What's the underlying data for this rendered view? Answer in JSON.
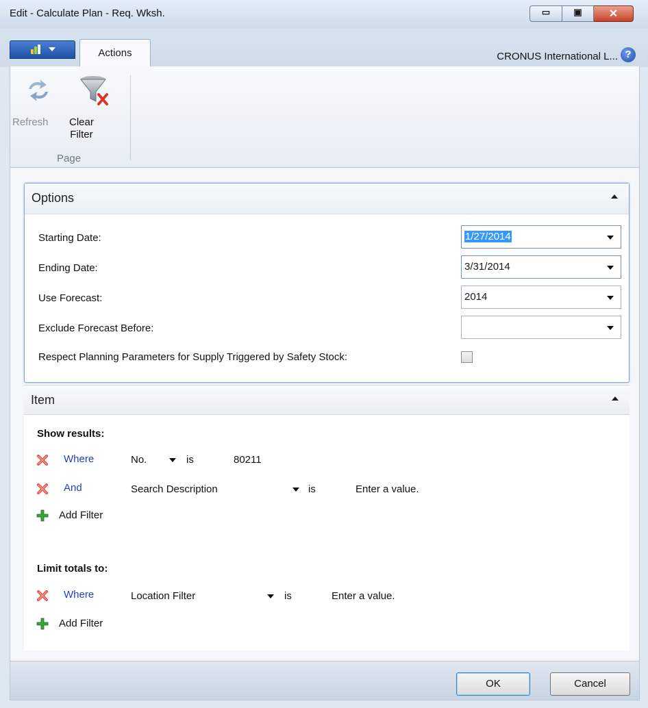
{
  "window": {
    "title": "Edit - Calculate Plan - Req. Wksh."
  },
  "window_controls": {
    "minimize": "▭",
    "maximize": "▣",
    "close": "✕"
  },
  "tabs": [
    {
      "label": "Actions"
    }
  ],
  "header": {
    "company": "CRONUS International L...",
    "help": "?"
  },
  "ribbon": {
    "refresh_label": "Refresh",
    "clear_filter_label_1": "Clear",
    "clear_filter_label_2": "Filter",
    "group_label": "Page"
  },
  "options": {
    "title": "Options",
    "fields": [
      {
        "label": "Starting Date:",
        "value": "1/27/2014"
      },
      {
        "label": "Ending Date:",
        "value": "3/31/2014"
      },
      {
        "label": "Use Forecast:",
        "value": "2014"
      },
      {
        "label": "Exclude Forecast Before:",
        "value": ""
      }
    ],
    "checkbox_label": "Respect Planning Parameters for Supply Triggered by Safety Stock:",
    "checkbox_checked": false
  },
  "item": {
    "title": "Item",
    "show_results_label": "Show results:",
    "filters": [
      {
        "connector": "Where",
        "field": "No.",
        "operator": "is",
        "value": "80211"
      },
      {
        "connector": "And",
        "field": "Search Description",
        "operator": "is",
        "value": "Enter a value."
      }
    ],
    "add_filter_label": "Add Filter",
    "limit_totals_label": "Limit totals to:",
    "limit_filters": [
      {
        "connector": "Where",
        "field": "Location Filter",
        "operator": "is",
        "value": "Enter a value."
      }
    ],
    "add_filter_label_2": "Add Filter"
  },
  "buttons": {
    "ok": "OK",
    "cancel": "Cancel"
  },
  "colors": {
    "link": "#2140c8",
    "selection": "#3399ff",
    "close_button": "#c7422a"
  }
}
